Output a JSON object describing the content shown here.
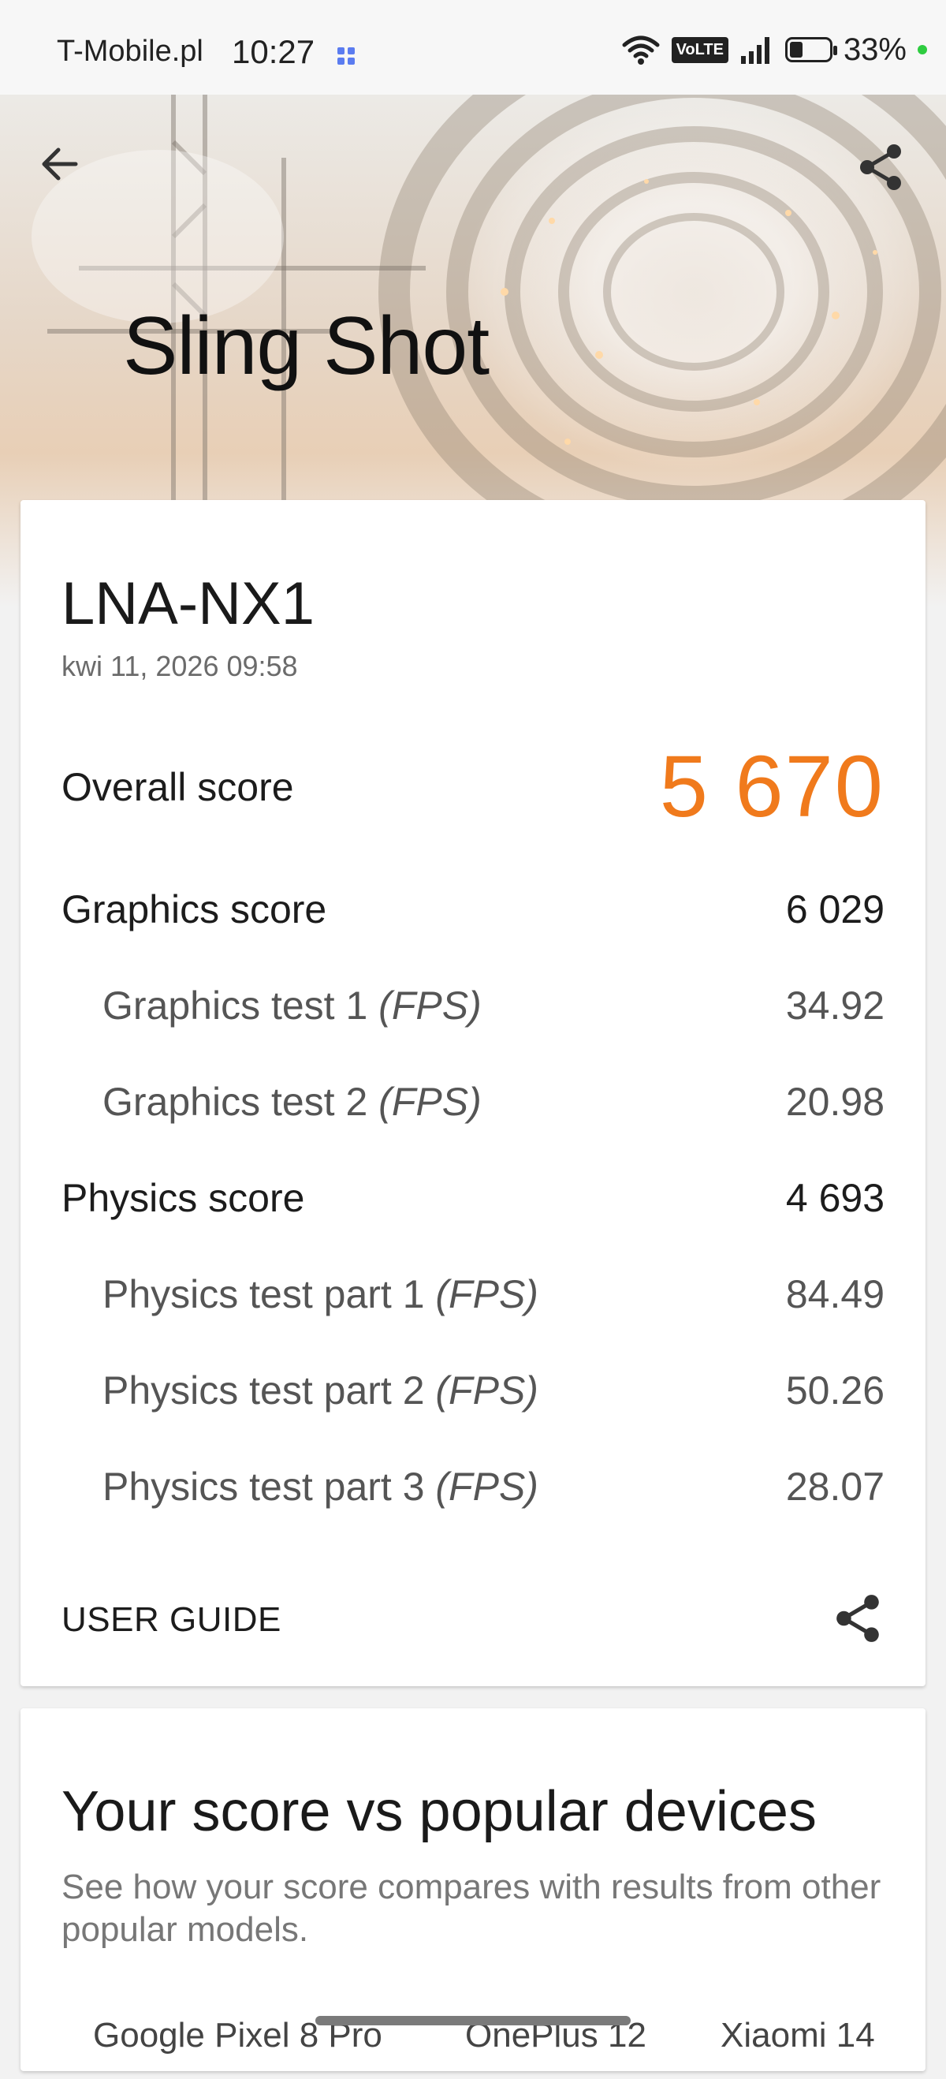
{
  "status_bar": {
    "carrier": "T-Mobile.pl",
    "time": "10:27",
    "volte": "VoLTE",
    "battery": "33%",
    "battery_level": 0.33
  },
  "header": {
    "title": "Sling Shot",
    "back_icon": "arrow-left-icon",
    "share_icon": "share-icon"
  },
  "result": {
    "device": "LNA-NX1",
    "datetime": "kwi 11, 2026 09:58",
    "overall": {
      "label": "Overall score",
      "value": "5 670"
    },
    "graphics": {
      "label": "Graphics score",
      "value": "6 029"
    },
    "graphics_tests": [
      {
        "label": "Graphics test 1",
        "unit": "(FPS)",
        "value": "34.92"
      },
      {
        "label": "Graphics test 2",
        "unit": "(FPS)",
        "value": "20.98"
      }
    ],
    "physics": {
      "label": "Physics score",
      "value": "4 693"
    },
    "physics_tests": [
      {
        "label": "Physics test part 1",
        "unit": "(FPS)",
        "value": "84.49"
      },
      {
        "label": "Physics test part 2",
        "unit": "(FPS)",
        "value": "50.26"
      },
      {
        "label": "Physics test part 3",
        "unit": "(FPS)",
        "value": "28.07"
      }
    ],
    "user_guide": "USER GUIDE",
    "accent_color": "#f07a1c"
  },
  "comparison": {
    "title": "Your score vs popular devices",
    "description": "See how your score compares with results from other popular models.",
    "devices": [
      "Google Pixel 8 Pro",
      "OnePlus 12",
      "Xiaomi 14"
    ]
  }
}
